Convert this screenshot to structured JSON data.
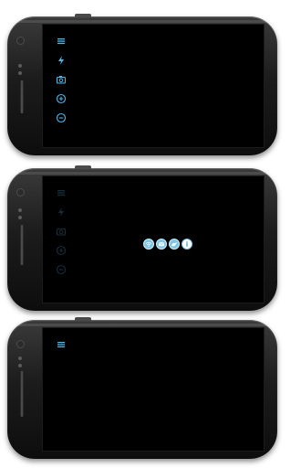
{
  "screens": [
    {
      "state": "menu-open",
      "menu_icons": [
        "menu-icon",
        "flash-icon",
        "camera-icon",
        "zoom-in-icon",
        "zoom-out-icon"
      ]
    },
    {
      "state": "share-overlay",
      "menu_icons": [
        "menu-icon",
        "flash-icon",
        "camera-icon",
        "zoom-in-icon",
        "zoom-out-icon"
      ],
      "share_icons": [
        "wifi-share-icon",
        "email-share-icon",
        "bird-share-icon",
        "info-icon"
      ]
    },
    {
      "state": "menu-collapsed",
      "menu_icons": [
        "menu-icon"
      ]
    }
  ],
  "colors": {
    "accent": "#4fb6e6",
    "screen": "#000000",
    "body": "#1c1c1c"
  }
}
